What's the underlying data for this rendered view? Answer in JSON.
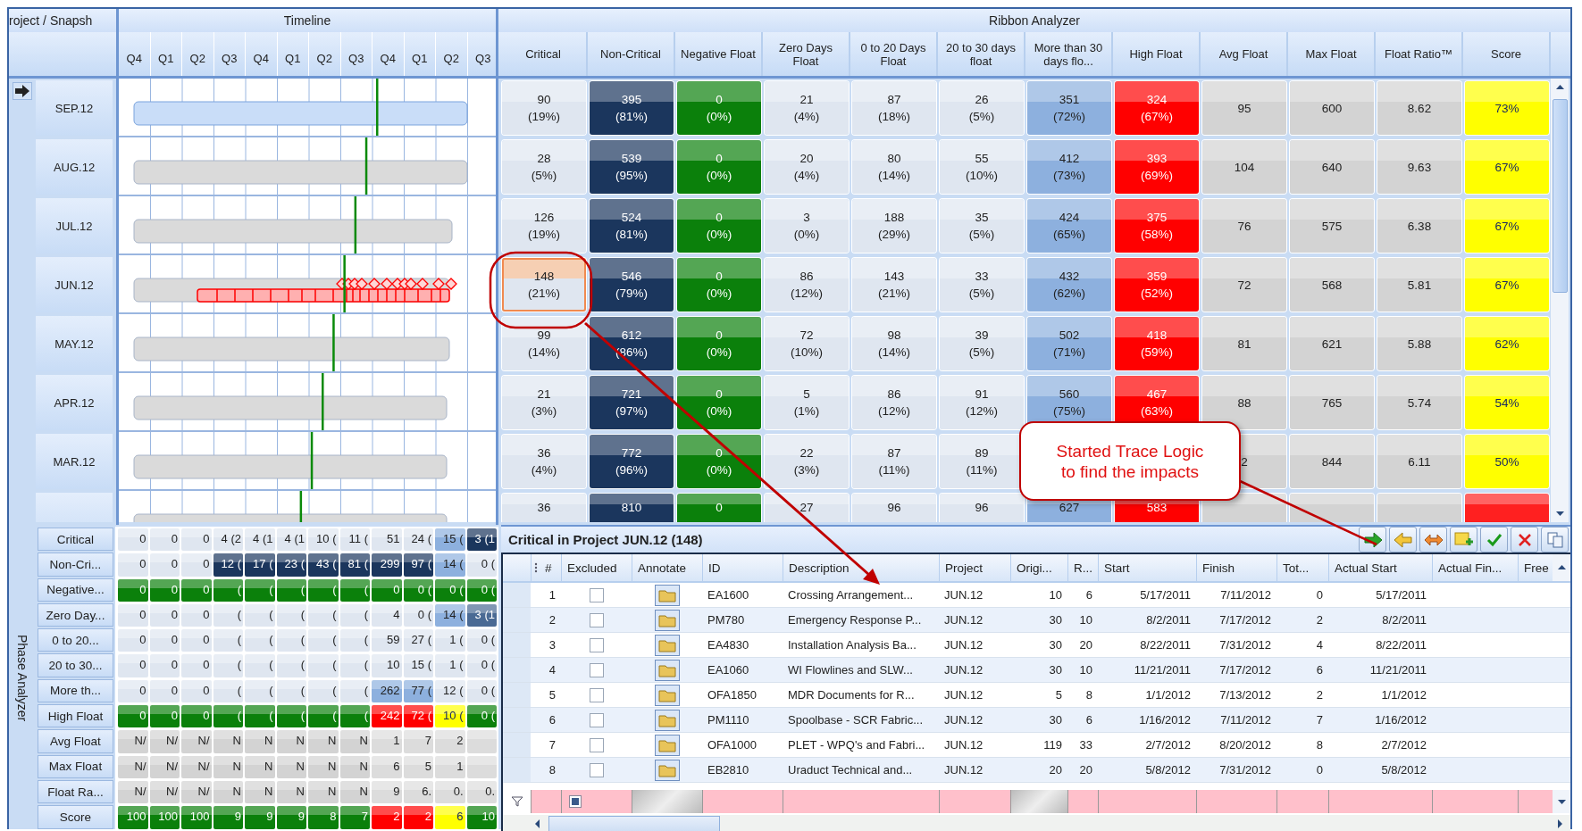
{
  "snapshot_header": "roject / Snapsh",
  "timeline": {
    "title": "Timeline",
    "quarters": [
      "Q4",
      "Q1",
      "Q2",
      "Q3",
      "Q4",
      "Q1",
      "Q2",
      "Q3",
      "Q4",
      "Q1",
      "Q2",
      "Q3"
    ]
  },
  "ribbon": {
    "title": "Ribbon Analyzer",
    "columns": [
      {
        "label": "Critical",
        "color": "#dfe6f0"
      },
      {
        "label": "Non-Critical",
        "color": "#1b365d"
      },
      {
        "label": "Negative Float",
        "color": "#0b800b"
      },
      {
        "label": "Zero Days Float",
        "color": "#dfe6f0"
      },
      {
        "label": "0 to 20 Days Float",
        "color": "#dfe6f0"
      },
      {
        "label": "20 to 30 days float",
        "color": "#dfe6f0"
      },
      {
        "label": "More than 30 days flo...",
        "color": "#8db0de"
      },
      {
        "label": "High Float",
        "color": "#ff0000"
      },
      {
        "label": "Avg Float",
        "color": "#d3d3d3"
      },
      {
        "label": "Max Float",
        "color": "#d3d3d3"
      },
      {
        "label": "Float Ratio™",
        "color": "#d3d3d3"
      },
      {
        "label": "Score",
        "color": "#ffff00"
      }
    ],
    "rows": [
      {
        "label": "SEP.12",
        "selected": true,
        "traced": false,
        "cells": [
          {
            "value": "90",
            "pct": "(19%)",
            "selected": false
          },
          {
            "value": "395",
            "pct": "(81%)",
            "selected": false
          },
          {
            "value": "0",
            "pct": "(0%)",
            "selected": false
          },
          {
            "value": "21",
            "pct": "(4%)",
            "selected": false
          },
          {
            "value": "87",
            "pct": "(18%)",
            "selected": false
          },
          {
            "value": "26",
            "pct": "(5%)",
            "selected": false
          },
          {
            "value": "351",
            "pct": "(72%)",
            "selected": false
          },
          {
            "value": "324",
            "pct": "(67%)",
            "selected": false
          },
          {
            "value": "95",
            "selected": false
          },
          {
            "value": "600",
            "selected": false
          },
          {
            "value": "8.62",
            "selected": false
          },
          {
            "value": "73%",
            "selected": false
          }
        ]
      },
      {
        "label": "AUG.12",
        "selected": false,
        "traced": false,
        "cells": [
          {
            "value": "28",
            "pct": "(5%)",
            "selected": false
          },
          {
            "value": "539",
            "pct": "(95%)",
            "selected": false
          },
          {
            "value": "0",
            "pct": "(0%)",
            "selected": false
          },
          {
            "value": "20",
            "pct": "(4%)",
            "selected": false
          },
          {
            "value": "80",
            "pct": "(14%)",
            "selected": false
          },
          {
            "value": "55",
            "pct": "(10%)",
            "selected": false
          },
          {
            "value": "412",
            "pct": "(73%)",
            "selected": false
          },
          {
            "value": "393",
            "pct": "(69%)",
            "selected": false
          },
          {
            "value": "104",
            "selected": false
          },
          {
            "value": "640",
            "selected": false
          },
          {
            "value": "9.63",
            "selected": false
          },
          {
            "value": "67%",
            "selected": false
          }
        ]
      },
      {
        "label": "JUL.12",
        "selected": false,
        "traced": false,
        "cells": [
          {
            "value": "126",
            "pct": "(19%)",
            "selected": false
          },
          {
            "value": "524",
            "pct": "(81%)",
            "selected": false
          },
          {
            "value": "0",
            "pct": "(0%)",
            "selected": false
          },
          {
            "value": "3",
            "pct": "(0%)",
            "selected": false
          },
          {
            "value": "188",
            "pct": "(29%)",
            "selected": false
          },
          {
            "value": "35",
            "pct": "(5%)",
            "selected": false
          },
          {
            "value": "424",
            "pct": "(65%)",
            "selected": false
          },
          {
            "value": "375",
            "pct": "(58%)",
            "selected": false
          },
          {
            "value": "76",
            "selected": false
          },
          {
            "value": "575",
            "selected": false
          },
          {
            "value": "6.38",
            "selected": false
          },
          {
            "value": "67%",
            "selected": false
          }
        ]
      },
      {
        "label": "JUN.12",
        "selected": false,
        "traced": true,
        "cells": [
          {
            "value": "148",
            "pct": "(21%)",
            "selected": true
          },
          {
            "value": "546",
            "pct": "(79%)",
            "selected": false
          },
          {
            "value": "0",
            "pct": "(0%)",
            "selected": false
          },
          {
            "value": "86",
            "pct": "(12%)",
            "selected": false
          },
          {
            "value": "143",
            "pct": "(21%)",
            "selected": false
          },
          {
            "value": "33",
            "pct": "(5%)",
            "selected": false
          },
          {
            "value": "432",
            "pct": "(62%)",
            "selected": false
          },
          {
            "value": "359",
            "pct": "(52%)",
            "selected": false
          },
          {
            "value": "72",
            "selected": false
          },
          {
            "value": "568",
            "selected": false
          },
          {
            "value": "5.81",
            "selected": false
          },
          {
            "value": "67%",
            "selected": false
          }
        ]
      },
      {
        "label": "MAY.12",
        "selected": false,
        "traced": false,
        "cells": [
          {
            "value": "99",
            "pct": "(14%)",
            "selected": false
          },
          {
            "value": "612",
            "pct": "(86%)",
            "selected": false
          },
          {
            "value": "0",
            "pct": "(0%)",
            "selected": false
          },
          {
            "value": "72",
            "pct": "(10%)",
            "selected": false
          },
          {
            "value": "98",
            "pct": "(14%)",
            "selected": false
          },
          {
            "value": "39",
            "pct": "(5%)",
            "selected": false
          },
          {
            "value": "502",
            "pct": "(71%)",
            "selected": false
          },
          {
            "value": "418",
            "pct": "(59%)",
            "selected": false
          },
          {
            "value": "81",
            "selected": false
          },
          {
            "value": "621",
            "selected": false
          },
          {
            "value": "5.88",
            "selected": false
          },
          {
            "value": "62%",
            "selected": false
          }
        ]
      },
      {
        "label": "APR.12",
        "selected": false,
        "traced": false,
        "cells": [
          {
            "value": "21",
            "pct": "(3%)",
            "selected": false
          },
          {
            "value": "721",
            "pct": "(97%)",
            "selected": false
          },
          {
            "value": "0",
            "pct": "(0%)",
            "selected": false
          },
          {
            "value": "5",
            "pct": "(1%)",
            "selected": false
          },
          {
            "value": "86",
            "pct": "(12%)",
            "selected": false
          },
          {
            "value": "91",
            "pct": "(12%)",
            "selected": false
          },
          {
            "value": "560",
            "pct": "(75%)",
            "selected": false
          },
          {
            "value": "467",
            "pct": "(63%)",
            "selected": false
          },
          {
            "value": "88",
            "selected": false
          },
          {
            "value": "765",
            "selected": false
          },
          {
            "value": "5.74",
            "selected": false
          },
          {
            "value": "54%",
            "selected": false
          }
        ]
      },
      {
        "label": "MAR.12",
        "selected": false,
        "traced": false,
        "cells": [
          {
            "value": "36",
            "pct": "(4%)",
            "selected": false
          },
          {
            "value": "772",
            "pct": "(96%)",
            "selected": false
          },
          {
            "value": "0",
            "pct": "(0%)",
            "selected": false
          },
          {
            "value": "22",
            "pct": "(3%)",
            "selected": false
          },
          {
            "value": "87",
            "pct": "(11%)",
            "selected": false
          },
          {
            "value": "89",
            "pct": "(11%)",
            "selected": false
          },
          {},
          {},
          {
            "value": "2",
            "selected": false
          },
          {
            "value": "844",
            "selected": false
          },
          {
            "value": "6.11",
            "selected": false
          },
          {
            "value": "50%",
            "selected": false
          }
        ]
      },
      {
        "selected": false,
        "traced": false,
        "cells": [
          {
            "value": "36",
            "selected": false
          },
          {
            "value": "810",
            "selected": false
          },
          {
            "value": "0",
            "selected": false
          },
          {
            "value": "27",
            "selected": false
          },
          {
            "value": "96",
            "selected": false
          },
          {
            "value": "96",
            "selected": false
          },
          {
            "value": "627",
            "selected": false
          },
          {
            "value": "583",
            "selected": false
          },
          {
            "selected": false
          },
          {
            "selected": false
          },
          {
            "selected": false
          },
          {
            "selected": false,
            "color": "#ff2020"
          }
        ]
      }
    ]
  },
  "phase_analyzer": {
    "title": "Phase Analyzer",
    "rows": [
      {
        "label": "Critical",
        "cells": [
          {
            "text": "0",
            "color": "#dfe6f0"
          },
          {
            "text": "0",
            "color": "#dfe6f0"
          },
          {
            "text": "0",
            "color": "#dfe6f0"
          },
          {
            "text": "4 (2",
            "color": "#dfe6f0"
          },
          {
            "text": "4 (1",
            "color": "#dfe6f0"
          },
          {
            "text": "4 (1",
            "color": "#dfe6f0"
          },
          {
            "text": "10 (",
            "color": "#dfe6f0"
          },
          {
            "text": "11 (",
            "color": "#dfe6f0"
          },
          {
            "text": "51",
            "color": "#dfe6f0"
          },
          {
            "text": "24 (",
            "color": "#dfe6f0"
          },
          {
            "text": "15 (",
            "color": "#8db0de"
          },
          {
            "text": "3 (1",
            "color": "#1b365d"
          }
        ]
      },
      {
        "label": "Non-Cri...",
        "cells": [
          {
            "text": "0",
            "color": "#dfe6f0"
          },
          {
            "text": "0",
            "color": "#dfe6f0"
          },
          {
            "text": "0",
            "color": "#dfe6f0"
          },
          {
            "text": "12 (",
            "color": "#1b365d"
          },
          {
            "text": "17 (",
            "color": "#1b365d"
          },
          {
            "text": "23 (",
            "color": "#1b365d"
          },
          {
            "text": "43 (",
            "color": "#1b365d"
          },
          {
            "text": "81 (",
            "color": "#1b365d"
          },
          {
            "text": "299",
            "color": "#1b365d"
          },
          {
            "text": "97 (",
            "color": "#1b365d"
          },
          {
            "text": "14 (",
            "color": "#8db0de"
          },
          {
            "text": "0 (",
            "color": "#dfe6f0"
          }
        ]
      },
      {
        "label": "Negative...",
        "cells": [
          {
            "text": "0",
            "color": "#0b800b"
          },
          {
            "text": "0",
            "color": "#0b800b"
          },
          {
            "text": "0",
            "color": "#0b800b"
          },
          {
            "text": "(",
            "color": "#0b800b"
          },
          {
            "text": "(",
            "color": "#0b800b"
          },
          {
            "text": "(",
            "color": "#0b800b"
          },
          {
            "text": "(",
            "color": "#0b800b"
          },
          {
            "text": "(",
            "color": "#0b800b"
          },
          {
            "text": "0",
            "color": "#0b800b"
          },
          {
            "text": "0 (",
            "color": "#0b800b"
          },
          {
            "text": "0 (",
            "color": "#0b800b"
          },
          {
            "text": "0 (",
            "color": "#0b800b"
          }
        ]
      },
      {
        "label": "Zero Day...",
        "cells": [
          {
            "text": "0",
            "color": "#dfe6f0"
          },
          {
            "text": "0",
            "color": "#dfe6f0"
          },
          {
            "text": "0",
            "color": "#dfe6f0"
          },
          {
            "text": "(",
            "color": "#dfe6f0"
          },
          {
            "text": "(",
            "color": "#dfe6f0"
          },
          {
            "text": "(",
            "color": "#dfe6f0"
          },
          {
            "text": "(",
            "color": "#dfe6f0"
          },
          {
            "text": "(",
            "color": "#dfe6f0"
          },
          {
            "text": "4",
            "color": "#dfe6f0"
          },
          {
            "text": "0 (",
            "color": "#dfe6f0"
          },
          {
            "text": "14 (",
            "color": "#8db0de"
          },
          {
            "text": "3 (1",
            "color": "#4a6a94"
          }
        ]
      },
      {
        "label": "0 to 20...",
        "cells": [
          {
            "text": "0",
            "color": "#dfe6f0"
          },
          {
            "text": "0",
            "color": "#dfe6f0"
          },
          {
            "text": "0",
            "color": "#dfe6f0"
          },
          {
            "text": "(",
            "color": "#dfe6f0"
          },
          {
            "text": "(",
            "color": "#dfe6f0"
          },
          {
            "text": "(",
            "color": "#dfe6f0"
          },
          {
            "text": "(",
            "color": "#dfe6f0"
          },
          {
            "text": "(",
            "color": "#dfe6f0"
          },
          {
            "text": "59",
            "color": "#dfe6f0"
          },
          {
            "text": "27 (",
            "color": "#dfe6f0"
          },
          {
            "text": "1 (",
            "color": "#dfe6f0"
          },
          {
            "text": "0 (",
            "color": "#dfe6f0"
          }
        ]
      },
      {
        "label": "20 to 30...",
        "cells": [
          {
            "text": "0",
            "color": "#dfe6f0"
          },
          {
            "text": "0",
            "color": "#dfe6f0"
          },
          {
            "text": "0",
            "color": "#dfe6f0"
          },
          {
            "text": "(",
            "color": "#dfe6f0"
          },
          {
            "text": "(",
            "color": "#dfe6f0"
          },
          {
            "text": "(",
            "color": "#dfe6f0"
          },
          {
            "text": "(",
            "color": "#dfe6f0"
          },
          {
            "text": "(",
            "color": "#dfe6f0"
          },
          {
            "text": "10",
            "color": "#dfe6f0"
          },
          {
            "text": "15 (",
            "color": "#dfe6f0"
          },
          {
            "text": "1 (",
            "color": "#dfe6f0"
          },
          {
            "text": "0 (",
            "color": "#dfe6f0"
          }
        ]
      },
      {
        "label": "More th...",
        "cells": [
          {
            "text": "0",
            "color": "#dfe6f0"
          },
          {
            "text": "0",
            "color": "#dfe6f0"
          },
          {
            "text": "0",
            "color": "#dfe6f0"
          },
          {
            "text": "(",
            "color": "#dfe6f0"
          },
          {
            "text": "(",
            "color": "#dfe6f0"
          },
          {
            "text": "(",
            "color": "#dfe6f0"
          },
          {
            "text": "(",
            "color": "#dfe6f0"
          },
          {
            "text": "(",
            "color": "#dfe6f0"
          },
          {
            "text": "262",
            "color": "#8db0de"
          },
          {
            "text": "77 (",
            "color": "#8db0de"
          },
          {
            "text": "12 (",
            "color": "#dfe6f0"
          },
          {
            "text": "0 (",
            "color": "#dfe6f0"
          }
        ]
      },
      {
        "label": "High Float",
        "cells": [
          {
            "text": "0",
            "color": "#0b800b"
          },
          {
            "text": "0",
            "color": "#0b800b"
          },
          {
            "text": "0",
            "color": "#0b800b"
          },
          {
            "text": "(",
            "color": "#0b800b"
          },
          {
            "text": "(",
            "color": "#0b800b"
          },
          {
            "text": "(",
            "color": "#0b800b"
          },
          {
            "text": "(",
            "color": "#0b800b"
          },
          {
            "text": "(",
            "color": "#0b800b"
          },
          {
            "text": "242",
            "color": "#ff0000"
          },
          {
            "text": "72 (",
            "color": "#ff0000"
          },
          {
            "text": "10 (",
            "color": "#ffff00"
          },
          {
            "text": "0 (",
            "color": "#0b800b"
          }
        ]
      },
      {
        "label": "Avg Float",
        "cells": [
          {
            "text": "N/",
            "color": "#d3d3d3"
          },
          {
            "text": "N/",
            "color": "#d3d3d3"
          },
          {
            "text": "N/",
            "color": "#d3d3d3"
          },
          {
            "text": "N",
            "color": "#d3d3d3"
          },
          {
            "text": "N",
            "color": "#d3d3d3"
          },
          {
            "text": "N",
            "color": "#d3d3d3"
          },
          {
            "text": "N",
            "color": "#d3d3d3"
          },
          {
            "text": "N",
            "color": "#d3d3d3"
          },
          {
            "text": "1",
            "color": "#dcdcdc"
          },
          {
            "text": "7",
            "color": "#dcdcdc"
          },
          {
            "text": "2",
            "color": "#dcdcdc"
          },
          {
            "color": "#dcdcdc"
          }
        ]
      },
      {
        "label": "Max Float",
        "cells": [
          {
            "text": "N/",
            "color": "#d3d3d3"
          },
          {
            "text": "N/",
            "color": "#d3d3d3"
          },
          {
            "text": "N/",
            "color": "#d3d3d3"
          },
          {
            "text": "N",
            "color": "#d3d3d3"
          },
          {
            "text": "N",
            "color": "#d3d3d3"
          },
          {
            "text": "N",
            "color": "#d3d3d3"
          },
          {
            "text": "N",
            "color": "#d3d3d3"
          },
          {
            "text": "N",
            "color": "#d3d3d3"
          },
          {
            "text": "6",
            "color": "#dcdcdc"
          },
          {
            "text": "5",
            "color": "#dcdcdc"
          },
          {
            "text": "1",
            "color": "#dcdcdc"
          },
          {
            "color": "#dcdcdc"
          }
        ]
      },
      {
        "label": "Float Ra...",
        "cells": [
          {
            "text": "N/",
            "color": "#d3d3d3"
          },
          {
            "text": "N/",
            "color": "#d3d3d3"
          },
          {
            "text": "N/",
            "color": "#d3d3d3"
          },
          {
            "text": "N",
            "color": "#d3d3d3"
          },
          {
            "text": "N",
            "color": "#d3d3d3"
          },
          {
            "text": "N",
            "color": "#d3d3d3"
          },
          {
            "text": "N",
            "color": "#d3d3d3"
          },
          {
            "text": "N",
            "color": "#d3d3d3"
          },
          {
            "text": "9",
            "color": "#dcdcdc"
          },
          {
            "text": "6.",
            "color": "#dcdcdc"
          },
          {
            "text": "0.",
            "color": "#dcdcdc"
          },
          {
            "text": "0.",
            "color": "#dcdcdc"
          }
        ]
      },
      {
        "label": "Score",
        "cells": [
          {
            "text": "100",
            "color": "#0b800b"
          },
          {
            "text": "100",
            "color": "#0b800b"
          },
          {
            "text": "100",
            "color": "#0b800b"
          },
          {
            "text": "9",
            "color": "#0b800b"
          },
          {
            "text": "9",
            "color": "#0b800b"
          },
          {
            "text": "9",
            "color": "#0b800b"
          },
          {
            "text": "8",
            "color": "#0b800b"
          },
          {
            "text": "7",
            "color": "#0b800b"
          },
          {
            "text": "2",
            "color": "#ff0000"
          },
          {
            "text": "2",
            "color": "#ff0000"
          },
          {
            "text": "6",
            "color": "#ffff00"
          },
          {
            "text": "10",
            "color": "#0b800b"
          }
        ]
      }
    ]
  },
  "detail": {
    "title": "Critical in Project JUN.12 (148)",
    "filter": {
      "excluded_mixed": true
    },
    "columns": [
      "#",
      "Excluded",
      "Annotate",
      "ID",
      "Description",
      "Project",
      "Origi...",
      "R...",
      "Start",
      "Finish",
      "Tot...",
      "Actual Start",
      "Actual Fin...",
      "Free"
    ],
    "rows": [
      {
        "number": "1",
        "excluded": false,
        "id": "EA1600",
        "description": "Crossing Arrangement...",
        "project": "JUN.12",
        "original": "10",
        "r": "6",
        "start": "5/17/2011",
        "finish": "7/11/2012",
        "total": "0",
        "actual_start": "5/17/2011"
      },
      {
        "number": "2",
        "excluded": false,
        "id": "PM780",
        "description": "Emergency Response P...",
        "project": "JUN.12",
        "original": "30",
        "r": "10",
        "start": "8/2/2011",
        "finish": "7/17/2012",
        "total": "2",
        "actual_start": "8/2/2011"
      },
      {
        "number": "3",
        "excluded": false,
        "id": "EA4830",
        "description": "Installation Analysis Ba...",
        "project": "JUN.12",
        "original": "30",
        "r": "20",
        "start": "8/22/2011",
        "finish": "7/31/2012",
        "total": "4",
        "actual_start": "8/22/2011"
      },
      {
        "number": "4",
        "excluded": false,
        "id": "EA1060",
        "description": "WI Flowlines and SLW...",
        "project": "JUN.12",
        "original": "30",
        "r": "10",
        "start": "11/21/2011",
        "finish": "7/17/2012",
        "total": "6",
        "actual_start": "11/21/2011"
      },
      {
        "number": "5",
        "excluded": false,
        "id": "OFA1850",
        "description": "MDR Documents for R...",
        "project": "JUN.12",
        "original": "5",
        "r": "8",
        "start": "1/1/2012",
        "finish": "7/13/2012",
        "total": "2",
        "actual_start": "1/1/2012"
      },
      {
        "number": "6",
        "excluded": false,
        "id": "PM1110",
        "description": "Spoolbase - SCR Fabric...",
        "project": "JUN.12",
        "original": "30",
        "r": "6",
        "start": "1/16/2012",
        "finish": "7/11/2012",
        "total": "7",
        "actual_start": "1/16/2012"
      },
      {
        "number": "7",
        "excluded": false,
        "id": "OFA1000",
        "description": "PLET - WPQ's and Fabri...",
        "project": "JUN.12",
        "original": "119",
        "r": "33",
        "start": "2/7/2012",
        "finish": "8/20/2012",
        "total": "8",
        "actual_start": "2/7/2012"
      },
      {
        "number": "8",
        "excluded": false,
        "id": "EB2810",
        "description": "Uraduct Technical and...",
        "project": "JUN.12",
        "original": "20",
        "r": "20",
        "start": "5/8/2012",
        "finish": "7/31/2012",
        "total": "0",
        "actual_start": "5/8/2012"
      }
    ]
  },
  "callout": {
    "text": "Started Trace Logic\nto find the impacts"
  }
}
